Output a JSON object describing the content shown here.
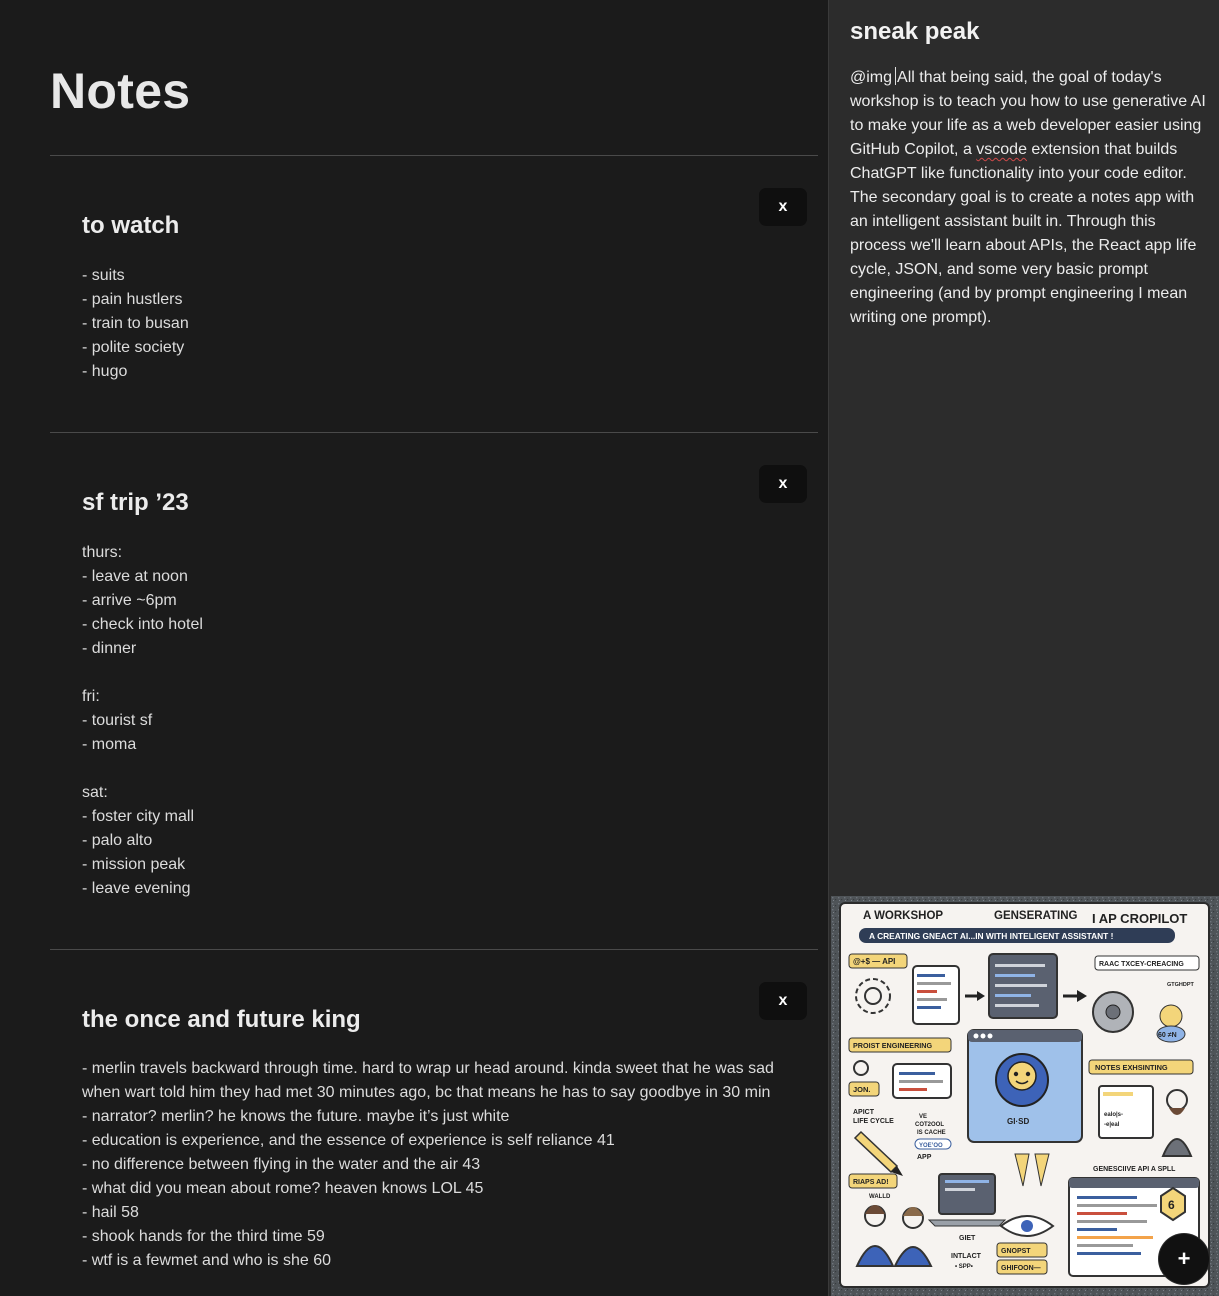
{
  "app": {
    "title": "Notes"
  },
  "notes": [
    {
      "title": "to watch",
      "body": "- suits\n- pain hustlers\n- train to busan\n- polite society\n- hugo",
      "delete_label": "x"
    },
    {
      "title": "sf trip ’23",
      "body": "thurs:\n- leave at noon\n- arrive ~6pm\n- check into hotel\n- dinner\n\nfri:\n- tourist sf\n- moma\n\nsat:\n- foster city mall\n- palo alto\n- mission peak\n- leave evening",
      "delete_label": "x"
    },
    {
      "title": "the once and future king",
      "body": "- merlin travels backward through time. hard to wrap ur head around. kinda sweet that he was sad when wart told him they had met 30 minutes ago, bc that means he has to say goodbye in 30 min\n- narrator? merlin? he knows the future. maybe it’s just white\n- education is experience, and the essence of experience is self reliance 41\n- no difference between flying in the water and the air 43\n- what did you mean about rome? heaven knows LOL 45\n- hail 58\n- shook hands for the third time 59\n- wtf is a fewmet and who is she 60",
      "delete_label": "x"
    }
  ],
  "preview": {
    "title": "sneak peak",
    "prefix": "@img",
    "text_before": "All that being said, the goal of today's workshop is to teach you how to use generative AI to make your life as a web developer easier using GitHub Copilot, a ",
    "misspelled": "vscode",
    "text_after": " extension that builds ChatGPT like functionality into your code editor. The secondary goal is to create a notes app with an intelligent assistant built in. Through this process we'll learn about APIs, the React app life cycle, JSON, and some very basic prompt engineering (and by prompt engineering I mean writing one prompt)."
  },
  "illustration": {
    "header_left": "A WORKSHOP",
    "header_mid": "GENSERATING",
    "header_right": "I AP CROPILOT",
    "banner": "A CREATING GNEACT AI...IN WITH INTELIGENT ASSISTANT !",
    "labels": {
      "api": "@+$ — API",
      "react": "RAAC TXCEY-CREACING",
      "gtgdpt": "GTGHDPT",
      "prompt": "PROIST ENGINEERING",
      "notes": "NOTES EXHSINTING",
      "json": "JON.",
      "lifecycle_1": "APICT",
      "lifecycle_2": "LIFE CYCLE",
      "ve": "VE",
      "cotdol": "COT2OOL",
      "cache": "IS CACHE",
      "yoeoo": "YOE’OO",
      "app": "APP",
      "gisd": "GI·SD",
      "riaps": "RIAPS AD!",
      "walld": "WALLD",
      "genai": "GENESCIIVE API A SPLL",
      "giet": "GIET",
      "intlact": "INTLACT",
      "spp": "• SPP•",
      "gnopst": "GNOPST",
      "ghifoon": "GHIFOON—",
      "ealois": "ealo|s-",
      "eleal": "-e|eal",
      "six": "6",
      "si": "60 ≠N"
    }
  },
  "fab": {
    "label": "+"
  }
}
